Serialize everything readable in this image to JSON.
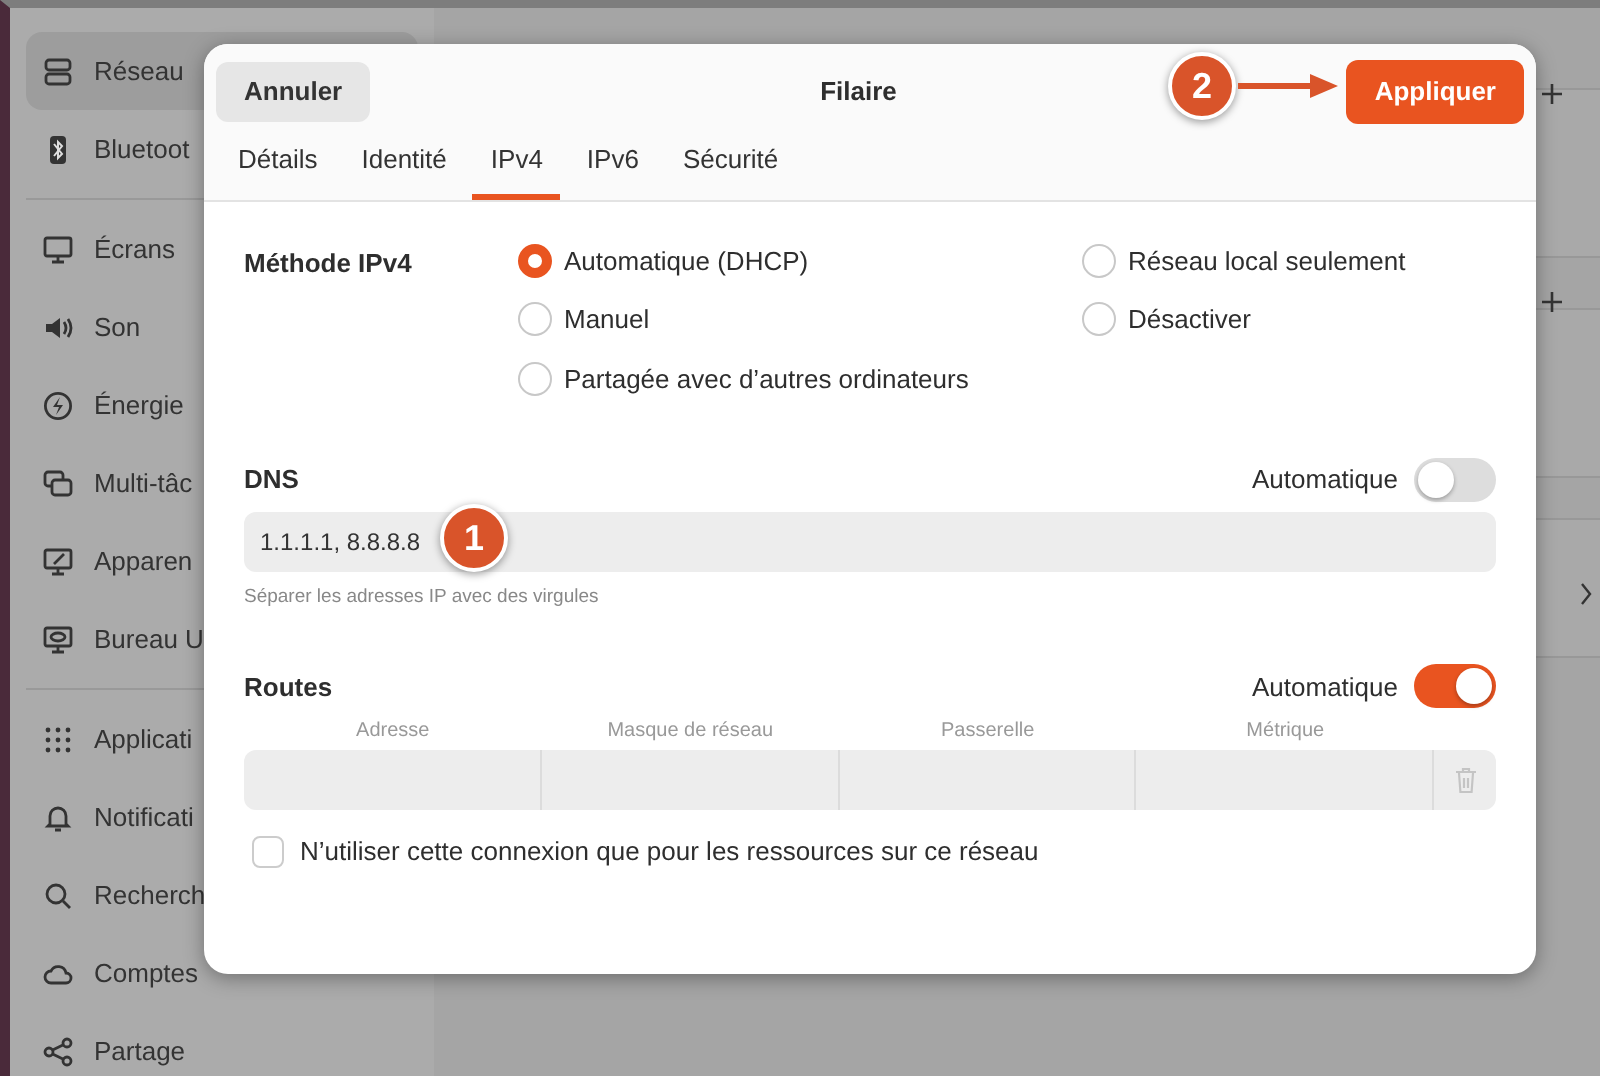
{
  "sidebar": {
    "groups": [
      [
        {
          "label": "Réseau",
          "selected": true
        },
        {
          "label": "Bluetoot",
          "selected": false
        }
      ],
      [
        {
          "label": "Écrans",
          "selected": false
        },
        {
          "label": "Son",
          "selected": false
        },
        {
          "label": "Énergie",
          "selected": false
        },
        {
          "label": "Multi-tâc",
          "selected": false
        },
        {
          "label": "Apparen",
          "selected": false
        },
        {
          "label": "Bureau U",
          "selected": false
        }
      ],
      [
        {
          "label": "Applicati",
          "selected": false
        },
        {
          "label": "Notificati",
          "selected": false
        },
        {
          "label": "Recherch",
          "selected": false
        },
        {
          "label": "Comptes",
          "selected": false
        },
        {
          "label": "Partage",
          "selected": false
        }
      ]
    ]
  },
  "dialog": {
    "title": "Filaire",
    "cancel": "Annuler",
    "apply": "Appliquer",
    "tabs": [
      {
        "label": "Détails",
        "selected": false
      },
      {
        "label": "Identité",
        "selected": false
      },
      {
        "label": "IPv4",
        "selected": true
      },
      {
        "label": "IPv6",
        "selected": false
      },
      {
        "label": "Sécurité",
        "selected": false
      }
    ],
    "method": {
      "label": "Méthode IPv4",
      "options": [
        {
          "label": "Automatique (DHCP)",
          "selected": true
        },
        {
          "label": "Réseau local seulement",
          "selected": false
        },
        {
          "label": "Manuel",
          "selected": false
        },
        {
          "label": "Désactiver",
          "selected": false
        },
        {
          "label": "Partagée avec d’autres ordinateurs",
          "selected": false
        }
      ]
    },
    "dns": {
      "label": "DNS",
      "toggle_label": "Automatique",
      "on": false,
      "value": "1.1.1.1, 8.8.8.8",
      "hint": "Séparer les adresses IP avec des virgules"
    },
    "routes": {
      "label": "Routes",
      "toggle_label": "Automatique",
      "on": true,
      "columns": [
        "Adresse",
        "Masque de réseau",
        "Passerelle",
        "Métrique"
      ]
    },
    "only_local": {
      "label": "N’utiliser cette connexion que pour les ressources sur ce réseau",
      "checked": false
    }
  },
  "annotations": [
    {
      "label": "1"
    },
    {
      "label": "2"
    }
  ]
}
